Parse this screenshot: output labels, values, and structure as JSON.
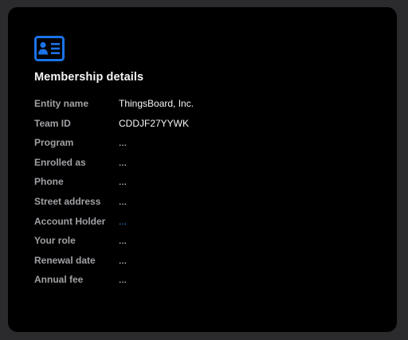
{
  "card": {
    "icon": "membership-id-card-icon",
    "title": "Membership details"
  },
  "details": [
    {
      "label": "Entity name",
      "value": "ThingsBoard, Inc.",
      "link": false
    },
    {
      "label": "Team ID",
      "value": "CDDJF27YYWK",
      "link": false
    },
    {
      "label": "Program",
      "value": "...",
      "link": false
    },
    {
      "label": "Enrolled as",
      "value": "...",
      "link": false
    },
    {
      "label": "Phone",
      "value": "...",
      "link": false
    },
    {
      "label": "Street address",
      "value": "...",
      "link": false
    },
    {
      "label": "Account Holder",
      "value": "...",
      "link": true
    },
    {
      "label": "Your role",
      "value": "...",
      "link": false
    },
    {
      "label": "Renewal date",
      "value": "...",
      "link": false
    },
    {
      "label": "Annual fee",
      "value": "...",
      "link": false
    }
  ],
  "colors": {
    "background": "#2b2b2d",
    "card": "#000000",
    "accent": "#1a73e8",
    "link": "#2997ff",
    "label": "#a1a1a6",
    "text": "#f5f5f7"
  }
}
